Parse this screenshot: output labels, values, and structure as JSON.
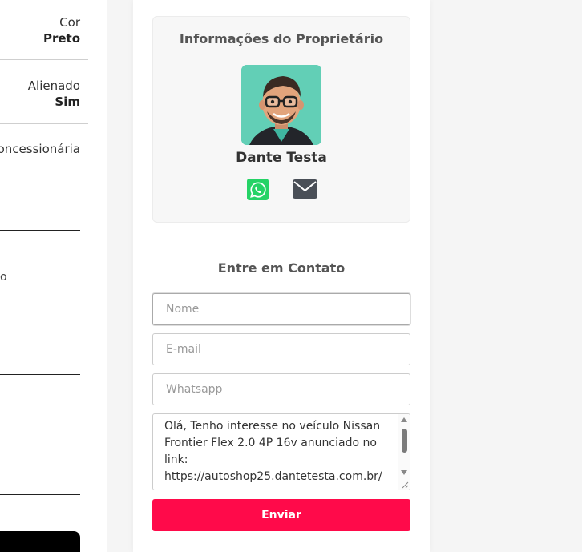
{
  "specs": {
    "cor": {
      "label": "Cor",
      "value": "Preto"
    },
    "alienado": {
      "label": "Alienado",
      "value": "Sim"
    },
    "concessionaria": {
      "label": "Concessionária"
    },
    "cut_text": "o"
  },
  "owner": {
    "title": "Informações do Proprietário",
    "name": "Dante Testa",
    "whatsapp_color": "#25d366"
  },
  "contact": {
    "title": "Entre em Contato",
    "nome_placeholder": "Nome",
    "email_placeholder": "E-mail",
    "whatsapp_placeholder": "Whatsapp",
    "message": "Olá, Tenho interesse no veículo Nissan Frontier Flex 2.0 4P 16v anunciado no link: https://autoshop25.dantetesta.com.br/v",
    "send_label": "Enviar",
    "send_color": "#ff0a4a"
  }
}
